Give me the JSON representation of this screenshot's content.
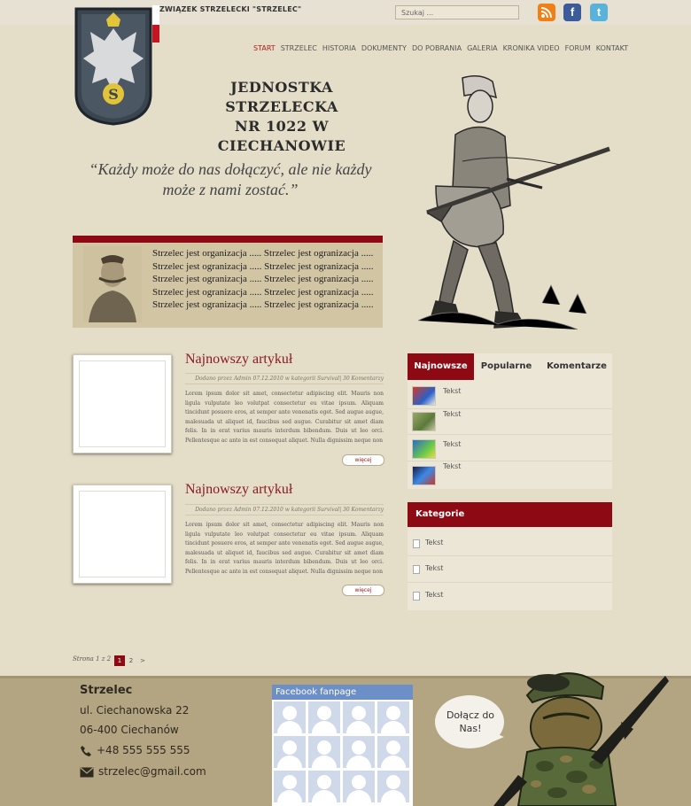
{
  "header": {
    "org_name": "ZWIĄZEK STRZELECKI \"STRZELEC\"",
    "search_placeholder": "Szukaj ...",
    "social": {
      "rss": "RSS",
      "facebook": "f",
      "twitter": "t"
    }
  },
  "nav": {
    "items": [
      "START",
      "STRZELEC",
      "HISTORIA",
      "DOKUMENTY",
      "DO POBRANIA",
      "GALERIA",
      "KRONIKA VIDEO",
      "FORUM",
      "KONTAKT"
    ],
    "active": "START"
  },
  "site_title": {
    "line1": "JEDNOSTKA STRZELECKA",
    "line2": "NR 1022 W CIECHANOWIE"
  },
  "quote": "“Każdy może do nas dołączyć, ale nie każdy może z nami zostać.”",
  "info_box": {
    "text": "Strzelec jest organizacja .....  Strzelec jest ogranizacja ..... Strzelec jest ogranizacja ..... Strzelec jest ogranizacja ..... Strzelec jest ogranizacja ..... Strzelec jest ogranizacja ..... Strzelec jest ogranizacja ..... Strzelec jest ogranizacja ..... Strzelec jest ogranizacja ..... Strzelec jest ogranizacja ....."
  },
  "articles": [
    {
      "title": "Najnowszy artykuł",
      "meta": "Dodano przez Admin 07.12.2010  w kategorii  Survival| 30 Komentarzy",
      "body": "Lorem ipsum dolor sit amet, consectetur adipiscing elit. Mauris non ligula vulputate leo volutpat consectetur eu vitae ipsum. Aliquam tincidunt posuere eros, at semper ante venenatis eget. Sed augue augue, malesuada ut aliquet id, faucibus sed augue. Curabitur sit amet diam felis. In in erat varius mauris interdum bibendum. Duis ut leo orci. Pellentesque ac ante in est consequat aliquet. Nulla dignissim neque non",
      "more": "więcej"
    },
    {
      "title": "Najnowszy artykuł",
      "meta": "Dodano przez Admin 07.12.2010  w kategorii  Survival| 30 Komentarzy",
      "body": "Lorem ipsum dolor sit amet, consectetur adipiscing elit. Mauris non ligula vulputate leo volutpat consectetur eu vitae ipsum. Aliquam tincidunt posuere eros, at semper ante venenatis eget. Sed augue augue, malesuada ut aliquet id, faucibus sed augue. Curabitur sit amet diam felis. In in erat varius mauris interdum bibendum. Duis ut leo orci. Pellentesque ac ante in est consequat aliquet. Nulla dignissim neque non",
      "more": "więcej"
    }
  ],
  "tabs": {
    "labels": [
      "Najnowsze",
      "Popularne",
      "Komentarze"
    ],
    "active": "Najnowsze",
    "items": [
      "Tekst",
      "Tekst",
      "Tekst",
      "Tekst"
    ]
  },
  "categories": {
    "title": "Kategorie",
    "items": [
      "Tekst",
      "Tekst",
      "Tekst"
    ]
  },
  "pagination": {
    "label": "Strona 1 z 2",
    "pages": [
      "1",
      "2"
    ],
    "next": ">"
  },
  "footer": {
    "name": "Strzelec",
    "street": "ul. Ciechanowska 22",
    "city": "06-400 Ciechanów",
    "phone": "+48 555 555 555",
    "email": "strzelec@gmail.com",
    "fb_title": "Facebook fanpage",
    "join_text": "Dołącz do Nas!"
  },
  "colors": {
    "accent": "#8d0a14",
    "background": "#e4ddc8",
    "footer": "#b3a482",
    "facebook": "#6c8fc7"
  }
}
